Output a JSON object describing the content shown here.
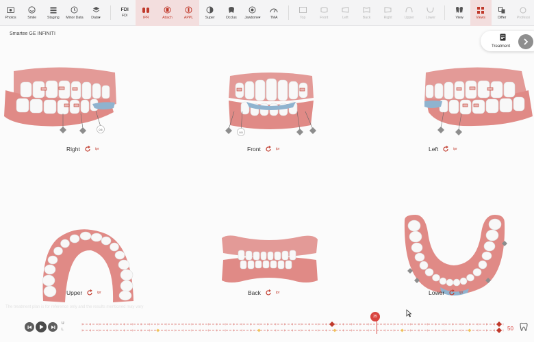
{
  "toolbar": {
    "items": [
      {
        "label": "Photos",
        "icon": "photos-icon",
        "state": "normal"
      },
      {
        "label": "Smile",
        "icon": "smile-icon",
        "state": "normal"
      },
      {
        "label": "Staging",
        "icon": "staging-icon",
        "state": "normal"
      },
      {
        "label": "Minor Data",
        "icon": "clock-icon",
        "state": "normal"
      },
      {
        "label": "Data▾",
        "icon": "layers-icon",
        "state": "normal"
      },
      {
        "label": "FDI",
        "icon": "fdi-text",
        "icon_text": "FDI",
        "state": "normal"
      },
      {
        "label": "IPR",
        "icon": "ipr-icon",
        "state": "active"
      },
      {
        "label": "Attach",
        "icon": "attach-icon",
        "state": "active"
      },
      {
        "label": "APPL",
        "icon": "appl-icon",
        "state": "active"
      },
      {
        "label": "Super",
        "icon": "super-icon",
        "state": "normal"
      },
      {
        "label": "Occlus",
        "icon": "occlus-icon",
        "state": "normal"
      },
      {
        "label": "Jawbone▾",
        "icon": "jawbone-icon",
        "state": "normal"
      },
      {
        "label": "TMA",
        "icon": "tma-icon",
        "state": "normal"
      },
      {
        "label": "Top",
        "icon": "view-top-icon",
        "state": "disabled"
      },
      {
        "label": "Front",
        "icon": "view-front-icon",
        "state": "disabled"
      },
      {
        "label": "Left",
        "icon": "view-left-icon",
        "state": "disabled"
      },
      {
        "label": "Back",
        "icon": "view-back-icon",
        "state": "disabled"
      },
      {
        "label": "Right",
        "icon": "view-right-icon",
        "state": "disabled"
      },
      {
        "label": "Upper",
        "icon": "view-upper-icon",
        "state": "disabled"
      },
      {
        "label": "Lower",
        "icon": "view-lower-icon",
        "state": "disabled"
      },
      {
        "label": "View",
        "icon": "teeth-view-icon",
        "state": "normal"
      },
      {
        "label": "Views",
        "icon": "grid-views-icon",
        "state": "active"
      },
      {
        "label": "Differ",
        "icon": "differ-icon",
        "state": "normal"
      },
      {
        "label": "Professi",
        "icon": "professional-icon",
        "state": "disabled"
      }
    ]
  },
  "title": "Smartee GE INFINITI",
  "treatment_button": {
    "label": "Treatment"
  },
  "views": [
    {
      "name": "Right",
      "tag": "ipr",
      "markers": [
        "0.5",
        "0.5",
        "0.5"
      ]
    },
    {
      "name": "Front",
      "tag": "ipr",
      "markers": [
        "0.5",
        "0.5",
        "0.5",
        "0.5"
      ]
    },
    {
      "name": "Left",
      "tag": "ipr",
      "markers": [
        "0.5",
        "0.5"
      ]
    },
    {
      "name": "Upper",
      "tag": "ipr"
    },
    {
      "name": "Back",
      "tag": "ipr"
    },
    {
      "name": "Lower",
      "tag": "ipr",
      "markers": [
        "0.5",
        "0.5",
        "0.5",
        "0.5"
      ]
    }
  ],
  "ghost_text": "The treatment plan is for reference only and the results mentioned may vary",
  "player": {
    "upper_label": "U",
    "lower_label": "L",
    "current_frame": "35",
    "total_frames": "50",
    "current_fraction": 0.7,
    "colors": {
      "accent": "#d9443f",
      "attachment": "#f0c25a",
      "gum": "#e08a86"
    }
  }
}
